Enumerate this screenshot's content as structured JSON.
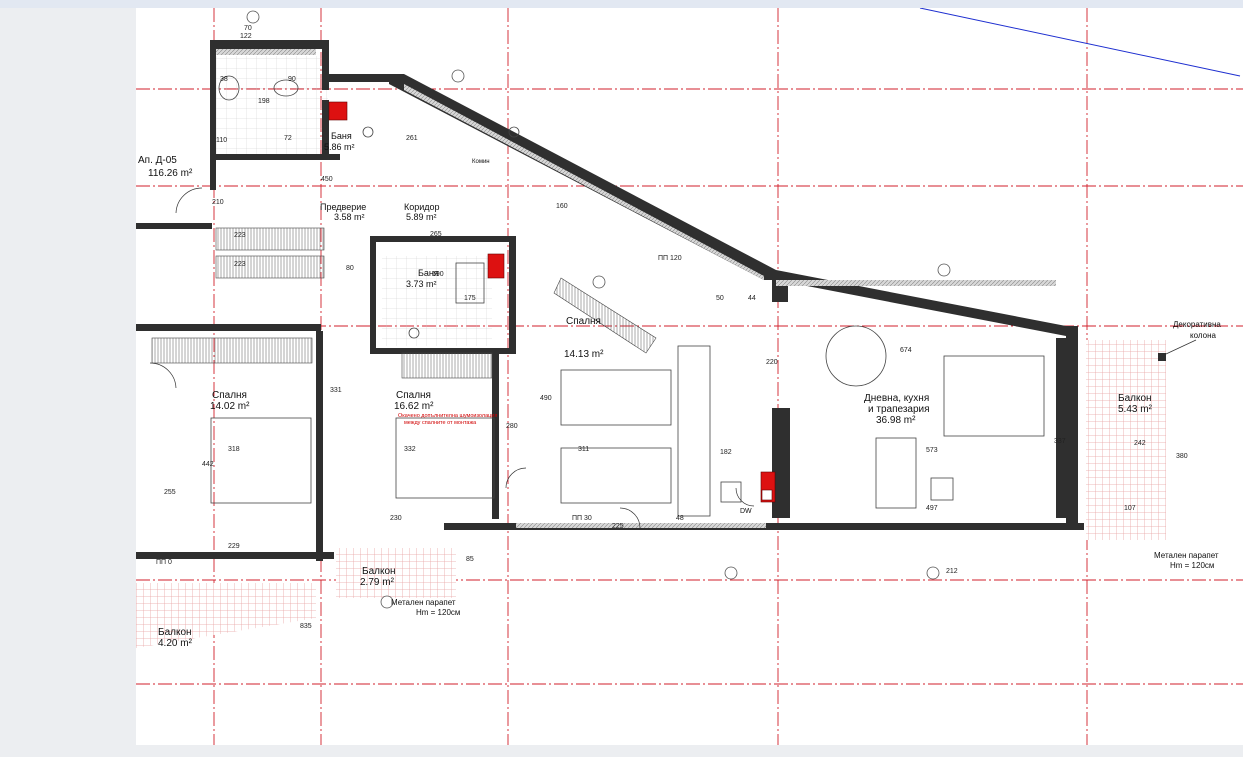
{
  "drawing": {
    "apartment": {
      "label": "Ап. Д-05",
      "area": "116.26 m²"
    },
    "rooms": [
      {
        "id": "bath1",
        "name": "Баня",
        "area": "5.86 m²"
      },
      {
        "id": "entry",
        "name": "Предверие",
        "area": "3.58 m²"
      },
      {
        "id": "corridor",
        "name": "Коридор",
        "area": "5.89 m²"
      },
      {
        "id": "bath2",
        "name": "Баня",
        "area": "3.73 m²"
      },
      {
        "id": "bed1",
        "name": "Спалня",
        "area": "14.02 m²"
      },
      {
        "id": "bed2",
        "name": "Спалня",
        "area": "16.62 m²"
      },
      {
        "id": "bed3",
        "name": "Спалня",
        "area": "14.13 m²"
      },
      {
        "id": "living",
        "name": "Дневна, кухня",
        "name2": "и трапезария",
        "area": "36.98 m²"
      },
      {
        "id": "balc1",
        "name": "Балкон",
        "area": "5.43 m²"
      },
      {
        "id": "balc2",
        "name": "Балкон",
        "area": "2.79 m²"
      },
      {
        "id": "balc3",
        "name": "Балкон",
        "area": "4.20 m²"
      }
    ],
    "notes": {
      "decor_col_1": "Декоративна",
      "decor_col_2": "колона",
      "parapet_1": "Метален парапет",
      "parapet_1_h": "Hm = 120см",
      "parapet_2": "Метален парапет",
      "parapet_2_h": "Hm = 120см",
      "shaft": "Комин",
      "dw": "DW",
      "acoustic_1": "Окачено допълнителна шумоизолация",
      "acoustic_2": "между спалните от монтажа"
    },
    "dimensions": {
      "d_70": "70",
      "d_122": "122",
      "d_38": "38",
      "d_90": "90",
      "d_198": "198",
      "d_110": "110",
      "d_72": "72",
      "d_261": "261",
      "d_450": "450",
      "d_265": "265",
      "d_223": "223",
      "d_190": "190",
      "d_175": "175",
      "d_318": "318",
      "d_332": "332",
      "d_311": "311",
      "d_442": "442",
      "d_490": "490",
      "d_280": "280",
      "d_674": "674",
      "d_573": "573",
      "d_220": "220",
      "d_497": "497",
      "d_212": "212",
      "d_229": "229",
      "d_225": "225",
      "d_230": "230",
      "d_182": "182",
      "d_380": "380",
      "d_242": "242",
      "d_107": "107",
      "d_160": "160",
      "d_210": "210",
      "d_331": "331",
      "d_255": "255",
      "d_337": "337",
      "d_80": "80",
      "d_48": "48",
      "d_50": "50",
      "d_44": "44",
      "d_85": "85",
      "d_835": "835",
      "d_pp30": "ПП 30",
      "d_pp0": "ПП 0",
      "d_pp120": "ПП 120"
    }
  },
  "colors": {
    "viewer_bg": "#eceef1",
    "sheet_bg": "#ffffff",
    "grid_axis": "#d21f2b",
    "wall_fill": "#2f2f2f",
    "wall_hatch": "#9a9a9a",
    "balcony_tile": "#e8a4a4",
    "sun_line": "#1e2fd0",
    "text": "#111111"
  }
}
